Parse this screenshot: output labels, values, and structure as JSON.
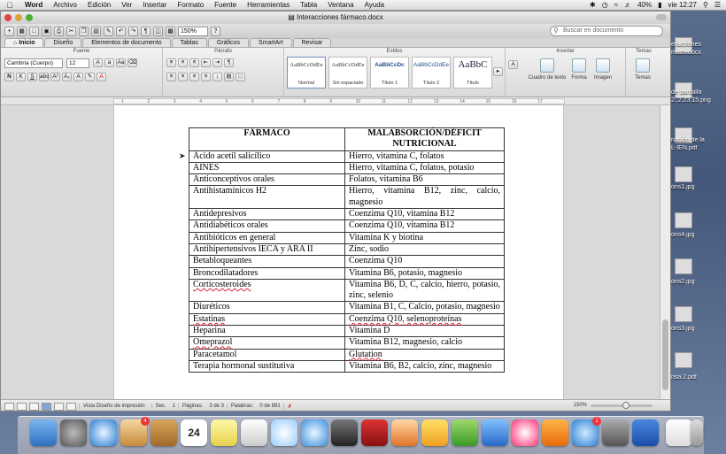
{
  "menubar": {
    "app_name": "Word",
    "items": [
      "Archivo",
      "Edición",
      "Ver",
      "Insertar",
      "Formato",
      "Fuente",
      "Herramientas",
      "Tabla",
      "Ventana",
      "Ayuda"
    ],
    "battery": "40%",
    "clock": "vie 12:27"
  },
  "window": {
    "title": "Interacciones fármaco.docx",
    "zoom": "150%",
    "search_placeholder": "Buscar en documento"
  },
  "ribbon": {
    "tabs": [
      "Inicio",
      "Diseño",
      "Elementos de documento",
      "Tablas",
      "Gráficos",
      "SmartArt",
      "Revisar"
    ],
    "groups": {
      "fuente": "Fuente",
      "parrafo": "Párrafo",
      "estilos": "Estilos",
      "insertar": "Insertar",
      "temas": "Temas"
    },
    "font_name": "Cambria (Cuerpo)",
    "font_size": "12",
    "styles": [
      {
        "sample": "AaBbCcDdEe",
        "name": "Normal"
      },
      {
        "sample": "AaBbCcDdEe",
        "name": "Sin espaciado"
      },
      {
        "sample": "AaBbCcDc",
        "name": "Título 1"
      },
      {
        "sample": "AaBbCcDdEe",
        "name": "Título 2"
      },
      {
        "sample": "AaBbC",
        "name": "Título"
      }
    ],
    "insert_buttons": [
      "Cuadro de texto",
      "Forma",
      "Imagen"
    ],
    "themes_button": "Temas"
  },
  "ruler": {
    "numbers": [
      "1",
      "2",
      "3",
      "4",
      "5",
      "6",
      "7",
      "8",
      "9",
      "10",
      "11",
      "12",
      "13",
      "14",
      "15",
      "16",
      "17"
    ]
  },
  "table": {
    "headers": [
      "FÁRMACO",
      "MALABSORCIÓN/DÉFICIT NUTRICIONAL"
    ],
    "rows": [
      [
        "Ácido acetil salicílico",
        "Hierro, vitamina C, folatos"
      ],
      [
        "AINES",
        "Hierro, vitamina C, folatos, potasio"
      ],
      [
        "Anticonceptivos orales",
        "Folatos, vitamina B6"
      ],
      [
        "Antihistamínicos H2",
        "Hierro, vitamina B12, zinc, calcio, magnesio"
      ],
      [
        "Antidepresivos",
        "Coenzima Q10, vitamina B12"
      ],
      [
        "Antidiabéticos orales",
        "Coenzima Q10, vitamina B12"
      ],
      [
        "Antibióticos en general",
        "Vitamina K y biotina"
      ],
      [
        "Antihipertensivos IECA y ARA II",
        "Zinc, sodio"
      ],
      [
        "Betabloqueantes",
        "Coenzima Q10"
      ],
      [
        "Broncodilatadores",
        "Vitamina B6, potasio, magnesio"
      ],
      [
        "Corticosteroides",
        "Vitamina B6, D, C, calcio, hierro, potasio, zinc, selenio"
      ],
      [
        "Diuréticos",
        "Vitamina B1, C, Calcio, potasio, magnesio"
      ],
      [
        "Estatinas",
        "Coenzima Q10, selenoproteínas"
      ],
      [
        "Heparina",
        "Vitamina D"
      ],
      [
        "Omeprazol",
        "Vitamina B12, magnesio, calcio"
      ],
      [
        "Paracetamol",
        "Glutation"
      ],
      [
        "Terapia hormonal sustitutiva",
        "Vitamina B6, B2, calcio, zinc, magnesio"
      ]
    ]
  },
  "statusbar": {
    "view": "Vista Diseño de impresión",
    "sec_label": "Sec.",
    "sec_value": "1",
    "pages_label": "Páginas:",
    "pages_value": "3 de 3",
    "words_label": "Palabras:",
    "words_value": "0 de 891",
    "zoom": "150%"
  },
  "desktop_files": [
    "eracciones",
    "maco.docx",
    "de pantalla",
    "2..2.23.15.png",
    "nación de la",
    "L-IEN.pdf",
    "ons1.jpg",
    "ons4.jpg",
    "ons2.jpg",
    "ons3.jpg",
    "de pantalla",
    "2..3.21.png",
    "nsa 2.pdf"
  ],
  "dock": {
    "calendar_day": "24",
    "mail_badge": "4",
    "appstore_badge": "1"
  }
}
